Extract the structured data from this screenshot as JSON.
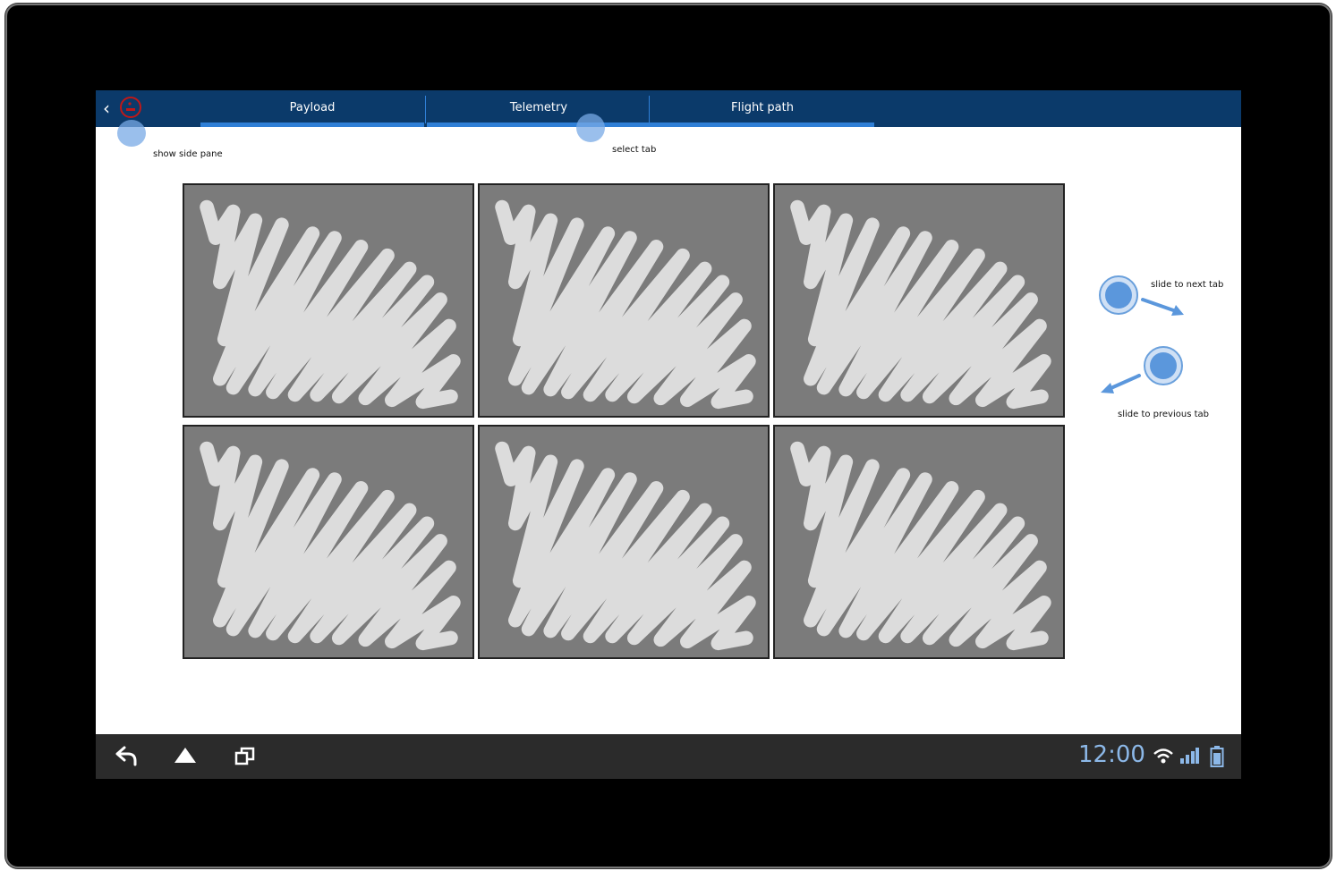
{
  "tabs": [
    {
      "label": "Payload",
      "selected": true
    },
    {
      "label": "Telemetry",
      "selected": false
    },
    {
      "label": "Flight path",
      "selected": false
    }
  ],
  "annotations": {
    "show_side_pane": "show side pane",
    "select_tab": "select tab",
    "slide_next": "slide to next tab",
    "slide_previous": "slide to previous tab"
  },
  "grid": {
    "tiles": [
      {
        "type": "image-placeholder"
      },
      {
        "type": "image-placeholder"
      },
      {
        "type": "image-placeholder"
      },
      {
        "type": "image-placeholder"
      },
      {
        "type": "image-placeholder"
      },
      {
        "type": "image-placeholder"
      }
    ]
  },
  "system_bar": {
    "time": "12:00",
    "icons": [
      "back-icon",
      "home-icon",
      "recent-apps-icon",
      "wifi-icon",
      "signal-icon",
      "battery-icon"
    ]
  },
  "colors": {
    "actionbar": "#0b3a6a",
    "tab_indicator": "#2f7fd6",
    "touch_hint": "#78aae6",
    "tile": "#7b7b7b",
    "scribble": "#dcdcdc",
    "navbar": "#2b2b2b",
    "clock": "#8cb8e8"
  }
}
